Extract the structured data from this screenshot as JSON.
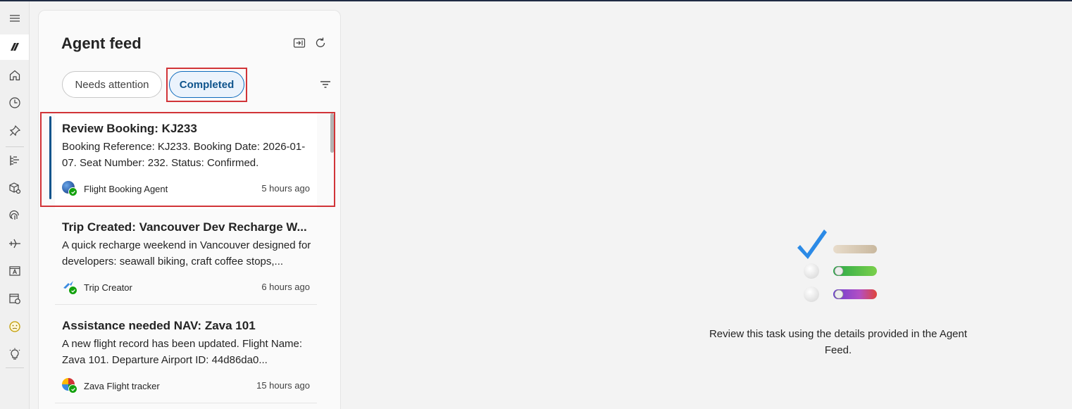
{
  "rail": {
    "items": [
      {
        "icon": "hamburger-menu-icon"
      },
      {
        "icon": "copilot-logo-icon",
        "active": true
      },
      {
        "icon": "home-icon"
      },
      {
        "icon": "clock-history-icon"
      },
      {
        "icon": "pin-icon"
      },
      {
        "icon": "tree-structure-icon"
      },
      {
        "icon": "cube-settings-icon"
      },
      {
        "icon": "fingerprint-icon"
      },
      {
        "icon": "flight-icon"
      },
      {
        "icon": "text-box-icon"
      },
      {
        "icon": "calendar-clock-icon"
      },
      {
        "icon": "emoji-icon"
      },
      {
        "icon": "lightbulb-icon"
      }
    ]
  },
  "feed": {
    "title": "Agent feed",
    "tabs": [
      {
        "label": "Needs attention",
        "selected": false
      },
      {
        "label": "Completed",
        "selected": true
      }
    ],
    "items": [
      {
        "title": "Review Booking: KJ233",
        "description": "Booking Reference: KJ233. Booking Date: 2026-01-07. Seat Number: 232. Status: Confirmed.",
        "agent": "Flight Booking Agent",
        "time": "5 hours ago",
        "selected": true
      },
      {
        "title": "Trip Created: Vancouver Dev Recharge W...",
        "description": "A quick recharge weekend in Vancouver designed for developers: seawall biking, craft coffee stops,...",
        "agent": "Trip Creator",
        "time": "6 hours ago",
        "selected": false
      },
      {
        "title": "Assistance needed NAV: Zava 101",
        "description": "A new flight record has been updated. Flight Name: Zava 101. Departure Airport ID: 44d86da0...",
        "agent": "Zava Flight tracker",
        "time": "15 hours ago",
        "selected": false
      }
    ]
  },
  "empty_state": {
    "message": "Review this task using the details provided in the Agent Feed."
  },
  "colors": {
    "accent": "#0f6cbd",
    "highlight": "#d13438",
    "success": "#13a10e"
  }
}
